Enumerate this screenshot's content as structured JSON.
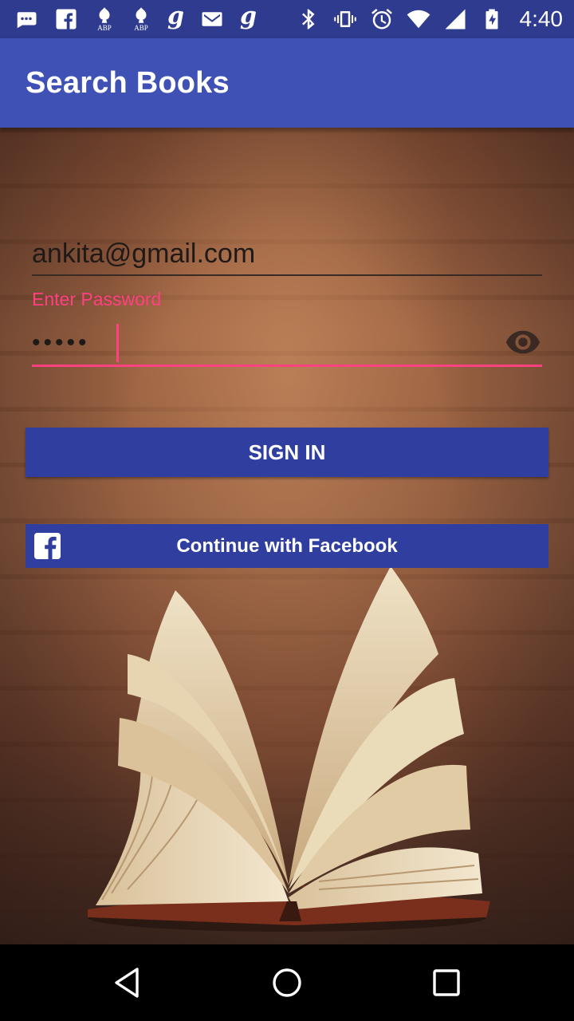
{
  "status_bar": {
    "time": "4:40",
    "abp_label_1": "ABP",
    "abp_label_2": "ABP",
    "g_icon_1": "g",
    "g_icon_2": "g",
    "icons_left": [
      "chat-icon",
      "facebook-icon",
      "abp-icon",
      "abp-icon",
      "g-app-icon",
      "gmail-icon",
      "g-app-icon"
    ],
    "icons_right": [
      "bluetooth-icon",
      "vibrate-icon",
      "alarm-icon",
      "wifi-icon",
      "cell-signal-icon",
      "battery-charging-icon"
    ]
  },
  "app_bar": {
    "title": "Search Books"
  },
  "form": {
    "email_value": "ankita@gmail.com",
    "password_label": "Enter Password",
    "password_value": "•••••",
    "sign_in_label": "SIGN IN",
    "facebook_label": "Continue with Facebook"
  },
  "colors": {
    "primary": "#3f51b5",
    "primary_dark": "#303f9f",
    "status_bar": "#2e3b8f",
    "accent": "#ff4081"
  },
  "nav_bar": {
    "icons": [
      "back-icon",
      "home-icon",
      "recents-icon"
    ]
  }
}
